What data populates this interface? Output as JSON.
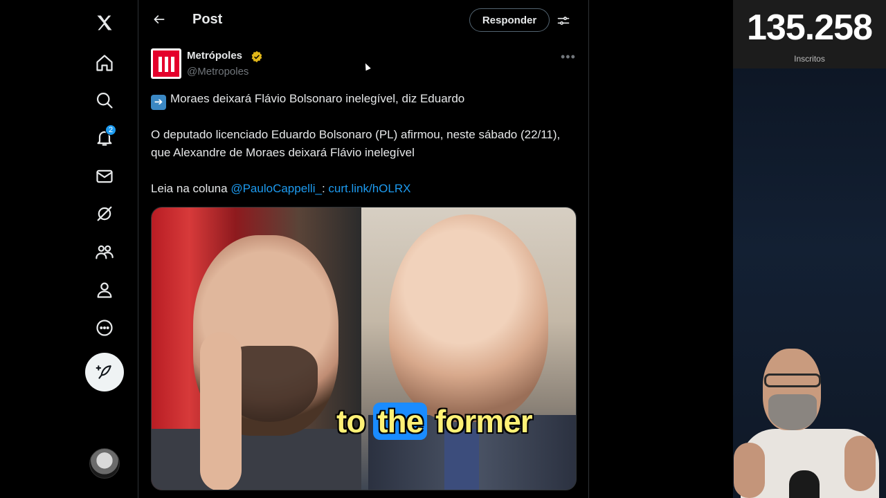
{
  "nav": {
    "items": [
      {
        "name": "x-logo-icon",
        "label": ""
      },
      {
        "name": "home-icon"
      },
      {
        "name": "search-icon"
      },
      {
        "name": "notifications-icon",
        "badge": "2"
      },
      {
        "name": "messages-icon"
      },
      {
        "name": "grok-icon"
      },
      {
        "name": "communities-icon"
      },
      {
        "name": "profile-icon"
      },
      {
        "name": "more-icon"
      }
    ]
  },
  "header": {
    "title": "Post",
    "reply_label": "Responder"
  },
  "post": {
    "author_name": "Metrópoles",
    "handle": "@Metropoles",
    "headline": "Moraes deixará Flávio Bolsonaro inelegível, diz Eduardo",
    "body": "O deputado licenciado Eduardo Bolsonaro (PL) afirmou, neste sábado (22/11), que Alexandre de Moraes deixará Flávio inelegível",
    "read_prefix": "Leia na coluna ",
    "mention": "@PauloCappelli_",
    "separator": ": ",
    "link": "curt.link/hOLRX"
  },
  "caption": {
    "words": [
      "to",
      "the",
      "former"
    ],
    "highlighted": "the"
  },
  "overlay": {
    "subscribers": "135.258",
    "subscribers_label": "Inscritos"
  },
  "colors": {
    "accent": "#1d9bf0",
    "brand_red": "#e4002b",
    "caption_yellow": "#fff176"
  }
}
